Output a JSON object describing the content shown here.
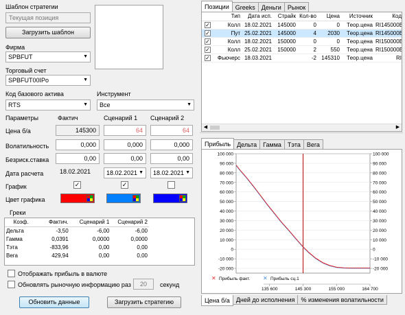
{
  "left": {
    "template_label": "Шаблон стратегии",
    "template_value": "Текущая позиция",
    "load_template_btn": "Загрузить шаблон",
    "firm_label": "Фирма",
    "firm_value": "SPBFUT",
    "account_label": "Торговый счет",
    "account_value": "SPBFUT00IPo",
    "base_asset_label": "Код базового актива",
    "base_asset_value": "RTS",
    "instrument_label": "Инструмент",
    "instrument_value": "Все"
  },
  "params": {
    "headers": [
      "Параметры",
      "Фактич",
      "Сценарий 1",
      "Сценарий 2"
    ],
    "rows": [
      {
        "label": "Цена б/а",
        "fact": "145300",
        "s1": "64",
        "s2": "64"
      },
      {
        "label": "Волатильность",
        "fact": "0,000",
        "s1": "0,000",
        "s2": "0,000"
      },
      {
        "label": "Безриск.ставка",
        "fact": "0,00",
        "s1": "0,00",
        "s2": "0,00"
      },
      {
        "label": "Дата расчета",
        "fact": "18.02.2021",
        "s1": "18.02.2021",
        "s2": "18.02.2021"
      }
    ],
    "chart_label": "График",
    "color_label": "Цвет графика",
    "colors": {
      "fact": "#ff0000",
      "s1": "#0080ff",
      "s2": "#0000ff"
    }
  },
  "greeks": {
    "title": "Греки",
    "headers": [
      "Коэф.",
      "Фактич.",
      "Сценарий 1",
      "Сценарий 2"
    ],
    "rows": [
      [
        "Дельта",
        "-3,50",
        "-6,00",
        "-6,00"
      ],
      [
        "Гамма",
        "0,0391",
        "0,0000",
        "0,0000"
      ],
      [
        "Тэта",
        "-833,96",
        "0,00",
        "0,00"
      ],
      [
        "Вега",
        "429,94",
        "0,00",
        "0,00"
      ]
    ]
  },
  "bottom": {
    "show_profit_currency": "Отображать прибыль в валюте",
    "refresh_label": "Обновлять рыночную информацию раз в",
    "refresh_value": "20",
    "seconds": "секунд",
    "update_btn": "Обновить данные",
    "load_strategy_btn": "Загрузить стратегию"
  },
  "positions": {
    "tabs": [
      "Позиции",
      "Greeks",
      "Деньги",
      "Рынок"
    ],
    "headers": [
      "Тип",
      "Дата исп.",
      "Страйк",
      "Кол-во",
      "Цена",
      "Источник",
      "Код"
    ],
    "rows": [
      {
        "checked": true,
        "selected": false,
        "cells": [
          "Колл",
          "18.02.2021",
          "145000",
          "0",
          "0",
          "Теор.цена",
          "RI145000B"
        ]
      },
      {
        "checked": true,
        "selected": true,
        "cells": [
          "Пут",
          "25.02.2021",
          "145000",
          "4",
          "2030",
          "Теор.цена",
          "RI145000B"
        ]
      },
      {
        "checked": true,
        "selected": false,
        "cells": [
          "Колл",
          "18.02.2021",
          "150000",
          "0",
          "0",
          "Теор.цена",
          "RI150000B"
        ]
      },
      {
        "checked": true,
        "selected": false,
        "cells": [
          "Колл",
          "25.02.2021",
          "150000",
          "2",
          "550",
          "Теор.цена",
          "RI150000BB"
        ]
      },
      {
        "checked": true,
        "selected": false,
        "cells": [
          "Фьючерс",
          "18.03.2021",
          "",
          "-2",
          "145310",
          "Теор.цена",
          "RI"
        ]
      }
    ]
  },
  "chart_panel": {
    "tabs": [
      "Прибыль",
      "Дельта",
      "Гамма",
      "Тэта",
      "Вега"
    ],
    "bottom_tabs": [
      "Цена б/а",
      "Дней до исполнения",
      "% изменения волатильности"
    ]
  },
  "chart_data": {
    "type": "line",
    "y_ticks": [
      100000,
      90000,
      80000,
      70000,
      60000,
      50000,
      40000,
      30000,
      20000,
      10000,
      0,
      -10000,
      -20000
    ],
    "y_tick_labels_left": [
      "100 000",
      "90 000",
      "80 000",
      "70 000",
      "60 000",
      "50 000",
      "40 000",
      "30 000",
      "20 000",
      "10 000",
      "0",
      "-10 000",
      "-20 000"
    ],
    "y_tick_labels_right": [
      "100 000",
      "90 000",
      "80 000",
      "70 000",
      "60 000",
      "50 000",
      "40 000",
      "30 000",
      "20 000",
      "10 000",
      "0",
      "-10 000",
      "-20 000"
    ],
    "ylim": [
      -25000,
      100000
    ],
    "xlim": [
      125900,
      164700
    ],
    "x_tick_labels": [
      "135 600",
      "145 300",
      "155 000",
      "164 700"
    ],
    "x_ticks": [
      135600,
      145300,
      155000,
      164700
    ],
    "current_price": 145300,
    "legend": [
      "Прибыль факт.",
      "Прибыль сц.1"
    ],
    "series": [
      {
        "name": "Прибыль факт.",
        "color": "#ff0000",
        "x": [
          125900,
          127000,
          128900,
          131000,
          133000,
          135000,
          137000,
          139000,
          141000,
          143000,
          145300,
          147000,
          149000,
          151000,
          153000,
          155000,
          157000,
          159000,
          161000,
          164700
        ],
        "y": [
          88000,
          83000,
          75000,
          65500,
          56000,
          46500,
          37500,
          28500,
          20500,
          12000,
          2500,
          -3500,
          -9500,
          -14000,
          -17000,
          -18800,
          -19500,
          -19700,
          -19700,
          -19700
        ]
      },
      {
        "name": "Прибыль сц.1",
        "color": "#4a8fd6",
        "x": [
          125900,
          127000,
          128900,
          131000,
          133000,
          135000,
          137000,
          139000,
          141000,
          143000,
          145300,
          147000,
          149000,
          151000,
          153000,
          155000,
          157000,
          159000,
          161000,
          164700
        ],
        "y": [
          87500,
          82500,
          74500,
          65000,
          55500,
          46000,
          37000,
          28000,
          20000,
          11500,
          2000,
          -4000,
          -10000,
          -14500,
          -17500,
          -19200,
          -19800,
          -20000,
          -20000,
          -20000
        ]
      }
    ]
  }
}
